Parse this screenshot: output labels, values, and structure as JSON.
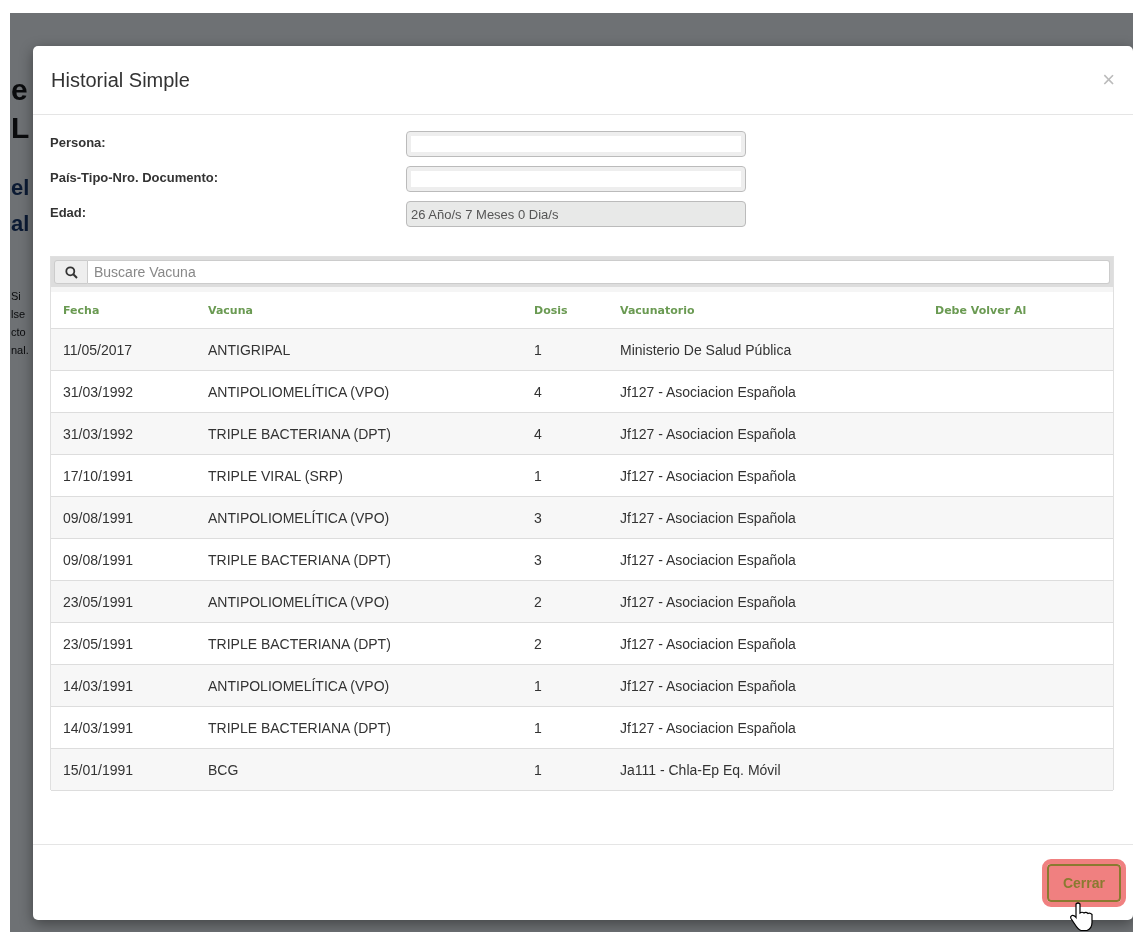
{
  "backdrop": {
    "fragments": [
      {
        "text": "e",
        "kind": "heading"
      },
      {
        "text": "L",
        "kind": "heading"
      },
      {
        "text": "el",
        "kind": "subheading"
      },
      {
        "text": "al",
        "kind": "subheading"
      },
      {
        "text": "Si",
        "kind": "body"
      },
      {
        "text": "lse",
        "kind": "body"
      },
      {
        "text": "cto",
        "kind": "body"
      },
      {
        "text": "nal.",
        "kind": "body"
      }
    ]
  },
  "modal": {
    "title": "Historial Simple",
    "close": "×",
    "fields": [
      {
        "label": "Persona:",
        "disabled": false
      },
      {
        "label": "País-Tipo-Nro. Documento:",
        "disabled": false
      },
      {
        "label": "Edad:",
        "value": "26 Año/s 7 Meses 0 Dia/s",
        "disabled": true
      }
    ],
    "search": {
      "placeholder": "Buscare Vacuna"
    },
    "table": {
      "columns": [
        "Fecha",
        "Vacuna",
        "Dosis",
        "Vacunatorio",
        "Debe Volver Al"
      ],
      "rows": [
        [
          "11/05/2017",
          "ANTIGRIPAL",
          "1",
          "Ministerio De Salud Pública",
          ""
        ],
        [
          "31/03/1992",
          "ANTIPOLIOMELÍTICA (VPO)",
          "4",
          "Jf127 - Asociacion Española",
          ""
        ],
        [
          "31/03/1992",
          "TRIPLE BACTERIANA (DPT)",
          "4",
          "Jf127 - Asociacion Española",
          ""
        ],
        [
          "17/10/1991",
          "TRIPLE VIRAL (SRP)",
          "1",
          "Jf127 - Asociacion Española",
          ""
        ],
        [
          "09/08/1991",
          "ANTIPOLIOMELÍTICA (VPO)",
          "3",
          "Jf127 - Asociacion Española",
          ""
        ],
        [
          "09/08/1991",
          "TRIPLE BACTERIANA (DPT)",
          "3",
          "Jf127 - Asociacion Española",
          ""
        ],
        [
          "23/05/1991",
          "ANTIPOLIOMELÍTICA (VPO)",
          "2",
          "Jf127 - Asociacion Española",
          ""
        ],
        [
          "23/05/1991",
          "TRIPLE BACTERIANA (DPT)",
          "2",
          "Jf127 - Asociacion Española",
          ""
        ],
        [
          "14/03/1991",
          "ANTIPOLIOMELÍTICA (VPO)",
          "1",
          "Jf127 - Asociacion Española",
          ""
        ],
        [
          "14/03/1991",
          "TRIPLE BACTERIANA (DPT)",
          "1",
          "Jf127 - Asociacion Española",
          ""
        ],
        [
          "15/01/1991",
          "BCG",
          "1",
          "Ja111 - Chla-Ep Eq. Móvil",
          ""
        ]
      ]
    },
    "buttons": [
      {
        "label": "Cerrar",
        "hovered": true
      }
    ]
  }
}
